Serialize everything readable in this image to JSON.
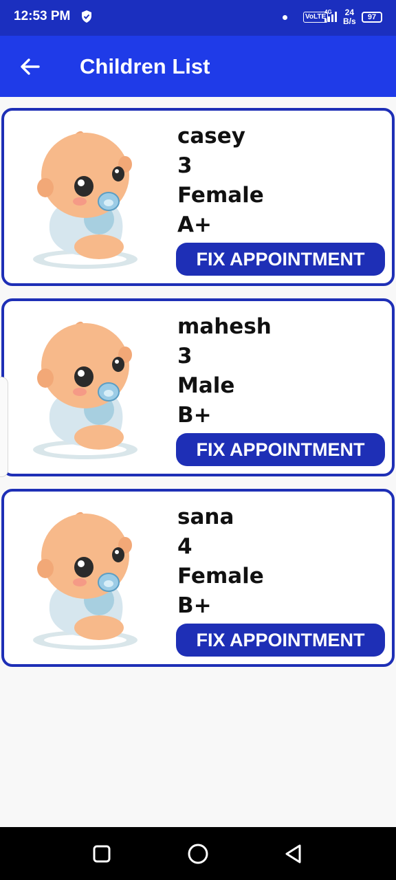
{
  "status_bar": {
    "time": "12:53 PM",
    "volte": "VoLTE",
    "net_speed_value": "24",
    "net_speed_unit": "B/s",
    "battery": "97",
    "icons": [
      "shield-icon",
      "dot-icon",
      "volte-icon",
      "signal-icon",
      "battery-icon"
    ]
  },
  "app_bar": {
    "title": "Children List",
    "back_icon": "arrow-left-icon"
  },
  "children": [
    {
      "name": "casey",
      "age": "3",
      "gender": "Female",
      "blood_group": "A+",
      "button": "FIX APPOINTMENT"
    },
    {
      "name": "mahesh",
      "age": "3",
      "gender": "Male",
      "blood_group": "B+",
      "button": "FIX APPOINTMENT"
    },
    {
      "name": "sana",
      "age": "4",
      "gender": "Female",
      "blood_group": "B+",
      "button": "FIX APPOINTMENT"
    }
  ],
  "nav_bar": {
    "icons": [
      "recents-square-icon",
      "home-circle-icon",
      "back-triangle-icon"
    ]
  },
  "colors": {
    "status_bar": "#1b2fbf",
    "app_bar": "#1f3be8",
    "card_border": "#1e2fb6",
    "button": "#1e2fb6",
    "background": "#f8f8f8"
  }
}
